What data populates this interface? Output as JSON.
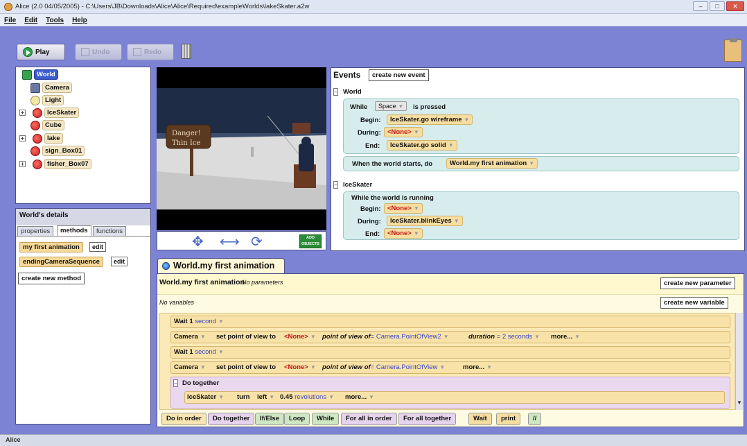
{
  "window": {
    "title": "Alice (2.0 04/05/2005) - C:\\Users\\JB\\Downloads\\Alice\\Alice\\Required\\exampleWorlds\\lakeSkater.a2w",
    "minimize": "–",
    "maximize": "□",
    "close": "✕"
  },
  "menu": [
    "File",
    "Edit",
    "Tools",
    "Help"
  ],
  "toolbar": {
    "play": "Play",
    "undo": "Undo",
    "redo": "Redo"
  },
  "object_tree": [
    {
      "label": "World",
      "icon": "world-icon",
      "selected": true
    },
    {
      "label": "Camera",
      "icon": "camera-icon"
    },
    {
      "label": "Light",
      "icon": "light-icon"
    },
    {
      "label": "IceSkater",
      "icon": "object-icon",
      "expandable": true
    },
    {
      "label": "Cube",
      "icon": "object-icon"
    },
    {
      "label": "lake",
      "icon": "object-icon",
      "expandable": true
    },
    {
      "label": "sign_Box01",
      "icon": "object-icon"
    },
    {
      "label": "fisher_Box07",
      "icon": "object-icon",
      "expandable": true
    }
  ],
  "details": {
    "title": "World's details",
    "tabs": [
      "properties",
      "methods",
      "functions"
    ],
    "methods": [
      {
        "name": "my first animation",
        "edit": "edit"
      },
      {
        "name": "endingCameraSequence",
        "edit": "edit"
      }
    ],
    "create_method": "create new method"
  },
  "scene": {
    "sign_line1": "Danger!",
    "sign_line2": "Thin Ice",
    "add_objects": "ADD OBJECTS"
  },
  "events": {
    "title": "Events",
    "create_button": "create new event",
    "group_world": "World",
    "while_label": "While",
    "key": "Space",
    "is_pressed": "is pressed",
    "begin_label": "Begin:",
    "during_label": "During:",
    "end_label": "End:",
    "begin_value_1": "IceSkater.go wireframe",
    "during_value_1": "<None>",
    "end_value_1": "IceSkater.go solid",
    "when_world_starts": "When the world starts,  do",
    "when_method": "World.my first animation",
    "group_iceskater": "IceSkater",
    "while_running": "While the world is running",
    "begin_value_2": "<None>",
    "during_value_2": "IceSkater.blinkEyes",
    "end_value_2": "<None>"
  },
  "editor": {
    "tab": "World.my first animation",
    "method_name": "World.my first animation",
    "no_params": "No parameters",
    "create_param": "create new parameter",
    "no_vars": "No variables",
    "create_var": "create new variable",
    "rows": {
      "wait1_kw": "Wait",
      "wait1_val": "1",
      "wait1_unit": "second",
      "cam1_obj": "Camera",
      "cam1_method": "set point of view to",
      "cam1_none": "<None>",
      "cam1_pov_label": "point of view of",
      "cam1_pov_value": "= Camera.PointOfView2",
      "cam1_dur_label": "duration",
      "cam1_dur_value": "= 2",
      "cam1_dur_unit": "seconds",
      "cam1_more": "more...",
      "wait2_kw": "Wait",
      "wait2_val": "1",
      "wait2_unit": "second",
      "cam2_obj": "Camera",
      "cam2_method": "set point of view to",
      "cam2_none": "<None>",
      "cam2_pov_label": "point of view of",
      "cam2_pov_value": "= Camera.PointOfView",
      "cam2_more": "more...",
      "dotogether": "Do together",
      "turn_obj": "IceSkater",
      "turn_kw": "turn",
      "turn_dir": "left",
      "turn_val": "0.45",
      "turn_unit": "revolutions",
      "turn_more": "more..."
    }
  },
  "bottom_buttons": [
    {
      "label": "Do in order",
      "color": "#f7e6b4"
    },
    {
      "label": "Do together",
      "color": "#e6d4ef"
    },
    {
      "label": "If/Else",
      "color": "#cfe8c3"
    },
    {
      "label": "Loop",
      "color": "#cfe8c3"
    },
    {
      "label": "While",
      "color": "#cfe8c3"
    },
    {
      "label": "For all in order",
      "color": "#e6d4ef"
    },
    {
      "label": "For all together",
      "color": "#e6d4ef"
    },
    {
      "label": "Wait",
      "color": "#f6dea2"
    },
    {
      "label": "print",
      "color": "#f6dea2"
    },
    {
      "label": "//",
      "color": "#cfe8c3"
    }
  ],
  "taskbar": {
    "label": "Alice"
  }
}
